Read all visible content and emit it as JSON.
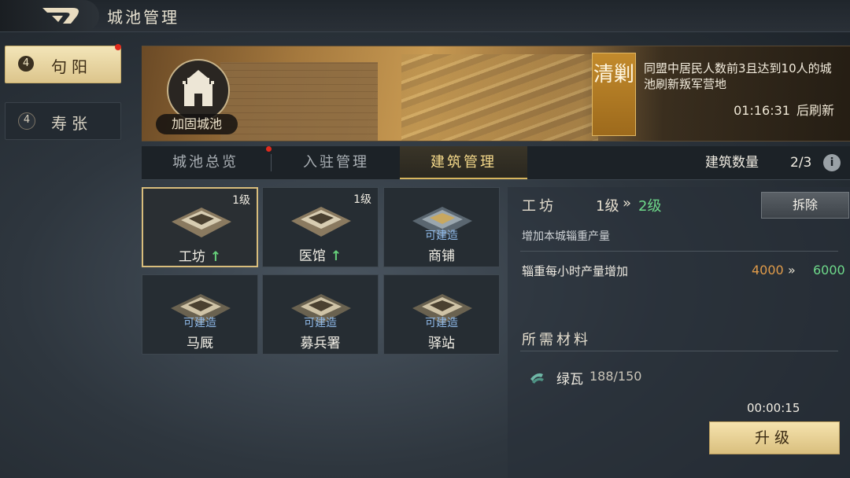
{
  "header": {
    "title": "城池管理"
  },
  "cities": [
    {
      "level": "4",
      "name": "句阳",
      "active": true
    },
    {
      "level": "4",
      "name": "寿张",
      "active": false
    }
  ],
  "banner": {
    "fort_label": "加固城池",
    "seal_text": "清剿",
    "description": "同盟中居民人数前3且达到10人的城池刷新叛军营地",
    "countdown": "01:16:31",
    "countdown_suffix": "后刷新"
  },
  "tabs": [
    {
      "label": "城池总览",
      "selected": false
    },
    {
      "label": "入驻管理",
      "selected": false
    },
    {
      "label": "建筑管理",
      "selected": true
    }
  ],
  "building_count": {
    "label": "建筑数量",
    "value": "2/3"
  },
  "buildings": [
    {
      "name": "工坊",
      "level": "1级",
      "status": "",
      "upgradable": true,
      "selected": true
    },
    {
      "name": "医馆",
      "level": "1级",
      "status": "",
      "upgradable": true,
      "selected": false
    },
    {
      "name": "商铺",
      "level": "",
      "status": "可建造",
      "upgradable": false,
      "selected": false
    },
    {
      "name": "马厩",
      "level": "",
      "status": "可建造",
      "upgradable": false,
      "selected": false
    },
    {
      "name": "募兵署",
      "level": "",
      "status": "可建造",
      "upgradable": false,
      "selected": false
    },
    {
      "name": "驿站",
      "level": "",
      "status": "可建造",
      "upgradable": false,
      "selected": false
    }
  ],
  "detail": {
    "name": "工坊",
    "level_from": "1级",
    "level_arrow": "»",
    "level_to": "2级",
    "demolish_label": "拆除",
    "description": "增加本城辎重产量",
    "stat_label": "辎重每小时产量增加",
    "stat_from": "4000",
    "stat_arrow": "»",
    "stat_to": "6000",
    "materials_title": "所需材料",
    "material": {
      "name": "绿瓦",
      "qty": "188/150"
    },
    "time": "00:00:15",
    "upgrade_label": "升级"
  },
  "colors": {
    "gold": "#d7b55e",
    "green": "#6ed98a",
    "orange": "#e09b4a",
    "blue_status": "#8fb9e8",
    "red_dot": "#e02a1c"
  },
  "icons": [
    "back-chevron-icon",
    "fortress-icon",
    "info-icon",
    "green-tile-icon",
    "upgrade-arrow-icon"
  ]
}
